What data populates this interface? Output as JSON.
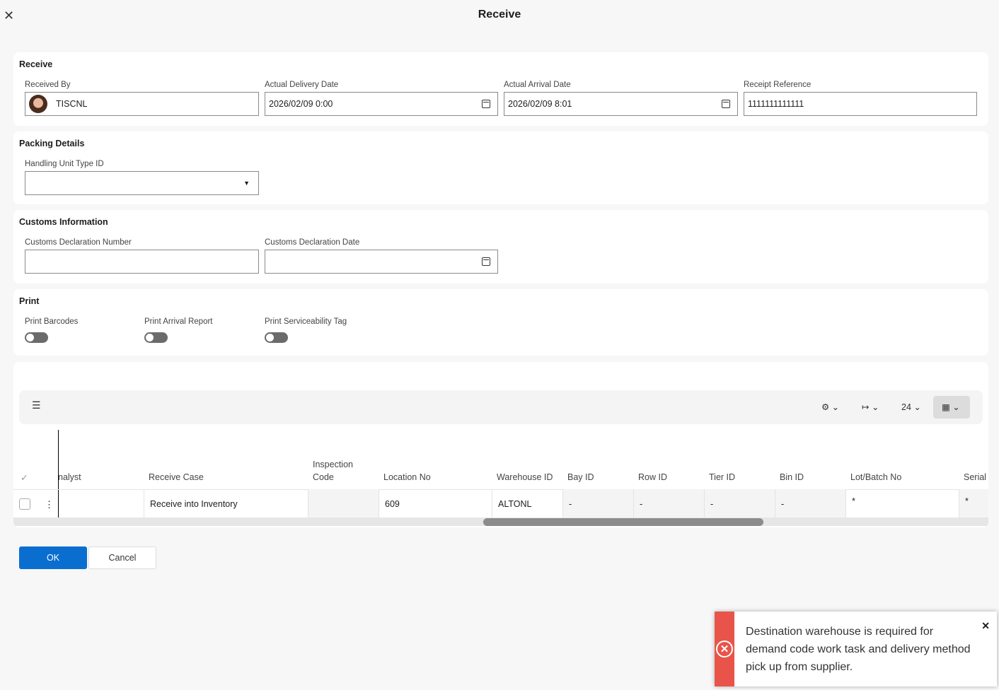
{
  "header": {
    "title": "Receive",
    "close_icon": "close-icon"
  },
  "receive": {
    "title": "Receive",
    "received_by_label": "Received By",
    "received_by": "TISCNL",
    "delivery_label": "Actual Delivery Date",
    "delivery": "2026/02/09 0:00",
    "arrival_label": "Actual Arrival Date",
    "arrival": "2026/02/09 8:01",
    "ref_label": "Receipt Reference",
    "ref": "1111111111111"
  },
  "packing": {
    "title": "Packing Details",
    "hu_label": "Handling Unit Type ID",
    "hu": ""
  },
  "customs": {
    "title": "Customs Information",
    "num_label": "Customs Declaration Number",
    "num": "",
    "date_label": "Customs Declaration Date",
    "date": ""
  },
  "print": {
    "title": "Print",
    "toggles": [
      {
        "label": "Print Barcodes",
        "on": false
      },
      {
        "label": "Print Arrival Report",
        "on": false
      },
      {
        "label": "Print Serviceability Tag",
        "on": false
      }
    ]
  },
  "table": {
    "page_size": "24",
    "columns": [
      "nalyst",
      "Receive Case",
      "Inspection",
      "Code",
      "Location No",
      "Warehouse ID",
      "Bay ID",
      "Row ID",
      "Tier ID",
      "Bin ID",
      "Lot/Batch No",
      "Serial"
    ],
    "row": {
      "analyst": "",
      "receive_case": "Receive into Inventory",
      "inspection_code": "",
      "location": "609",
      "warehouse": "ALTONL",
      "bay": "-",
      "row": "-",
      "tier": "-",
      "bin": "-",
      "lot": "*",
      "serial": "*"
    }
  },
  "buttons": {
    "ok": "OK",
    "cancel": "Cancel"
  },
  "toast": {
    "message": "Destination warehouse is required for demand code work task and delivery method pick up from supplier.",
    "color": "#e9544a"
  }
}
